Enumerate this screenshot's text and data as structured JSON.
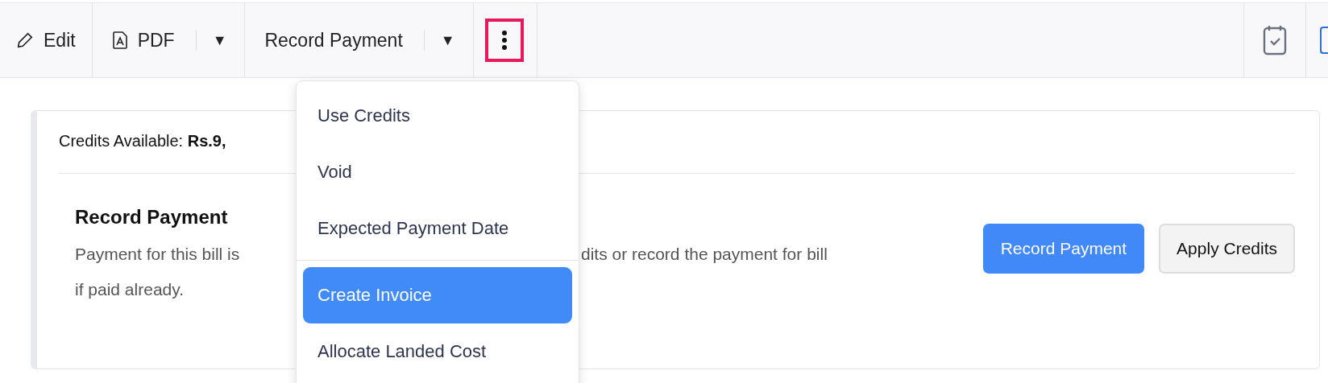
{
  "toolbar": {
    "items": [
      {
        "kind": "edit",
        "label": "Edit"
      },
      {
        "kind": "split",
        "label": "PDF",
        "caret": "▼"
      },
      {
        "kind": "split",
        "label": "Record Payment",
        "caret": "▼"
      },
      {
        "kind": "more"
      }
    ]
  },
  "menu": {
    "items": [
      {
        "label": "Use Credits",
        "selected": false,
        "divider_after": false
      },
      {
        "label": "Void",
        "selected": false,
        "divider_after": false
      },
      {
        "label": "Expected Payment Date",
        "selected": false,
        "divider_after": true
      },
      {
        "label": "Create Invoice",
        "selected": true,
        "divider_after": false
      },
      {
        "label": "Allocate Landed Cost",
        "selected": false,
        "divider_after": false
      }
    ]
  },
  "card": {
    "credits": "Credits Available: **Rs.9,**",
    "heading": "Record Payment",
    "text_left": [
      "Payment for this bill is",
      "if paid already."
    ],
    "text_right": "dits or record the payment for bill",
    "buttons": [
      {
        "label": "Record Payment",
        "kind": "primary"
      },
      {
        "label": "Apply Credits",
        "kind": "secondary"
      }
    ]
  }
}
